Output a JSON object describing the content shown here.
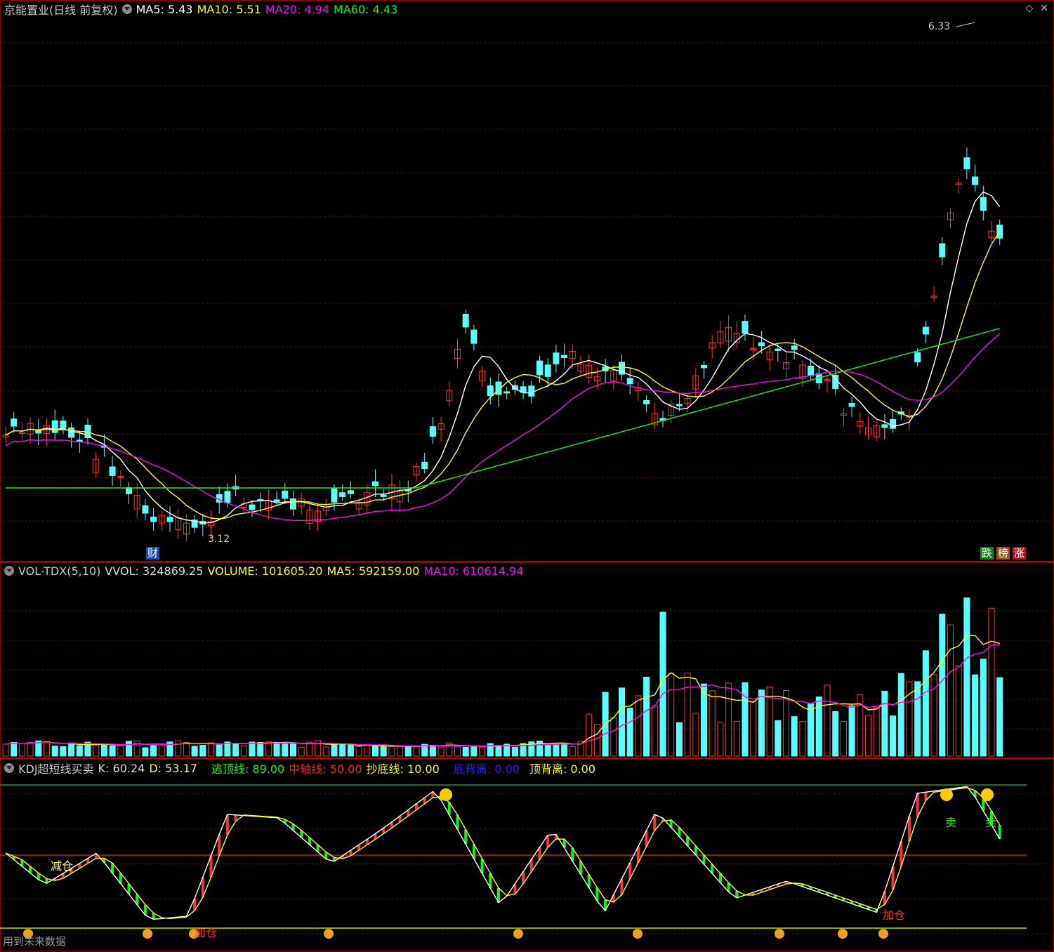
{
  "main_panel": {
    "title": "京能置业(日线 前复权)",
    "ma5": "MA5: 5.43",
    "ma10": "MA10: 5.51",
    "ma20": "MA20: 4.94",
    "ma60": "MA60: 4.43",
    "peak_label": "6.33",
    "low_label": "3.12",
    "finance_marker": "财",
    "tags": [
      "跌",
      "榜",
      "涨"
    ],
    "icons": [
      "diamond-icon",
      "close-icon"
    ]
  },
  "vol_panel": {
    "name": "VOL-TDX(5,10)",
    "vvol": "VVOL: 324869.25",
    "volume": "VOLUME: 101605.20",
    "ma5": "MA5: 592159.00",
    "ma10": "MA10: 610614.94"
  },
  "kdj_panel": {
    "name": "KDJ超短线买卖",
    "k": "K: 60.24",
    "d": "D: 53.17",
    "escape_line": "逃顶线: 89.00",
    "mid_line": "中轴线: 50.00",
    "bottom_line": "抄底线: 10.00",
    "bottom_div": "底背离: 0.00",
    "top_div": "顶背离: 0.00",
    "signals": {
      "reduce": "减仓",
      "add1": "加仓",
      "add2": "加仓",
      "sell1": "卖",
      "sell2": "卖"
    }
  },
  "footer_note": "用到未来数据",
  "colors": {
    "up": "#ff3232",
    "down": "#54ffff",
    "ma5": "#ffffff",
    "ma10": "#ffff00",
    "ma20": "#ff00ff",
    "ma60": "#00ff00",
    "grid": "#8b0000"
  },
  "chart_data": [
    {
      "type": "candlestick",
      "title": "京能置业(日线 前复权)",
      "series": [
        {
          "name": "MA5",
          "last": 5.43
        },
        {
          "name": "MA10",
          "last": 5.51
        },
        {
          "name": "MA20",
          "last": 4.94
        },
        {
          "name": "MA60",
          "last": 4.43
        }
      ],
      "annotations": {
        "high": 6.33,
        "low": 3.12
      }
    },
    {
      "type": "bar",
      "title": "VOL-TDX(5,10)",
      "series": [
        {
          "name": "VOLUME",
          "last": 101605.2
        },
        {
          "name": "MA5",
          "last": 592159.0
        },
        {
          "name": "MA10",
          "last": 610614.94
        }
      ]
    },
    {
      "type": "line",
      "title": "KDJ超短线买卖",
      "series": [
        {
          "name": "K",
          "last": 60.24
        },
        {
          "name": "D",
          "last": 53.17
        }
      ],
      "levels": {
        "逃顶线": 89.0,
        "中轴线": 50.0,
        "抄底线": 10.0
      }
    }
  ]
}
